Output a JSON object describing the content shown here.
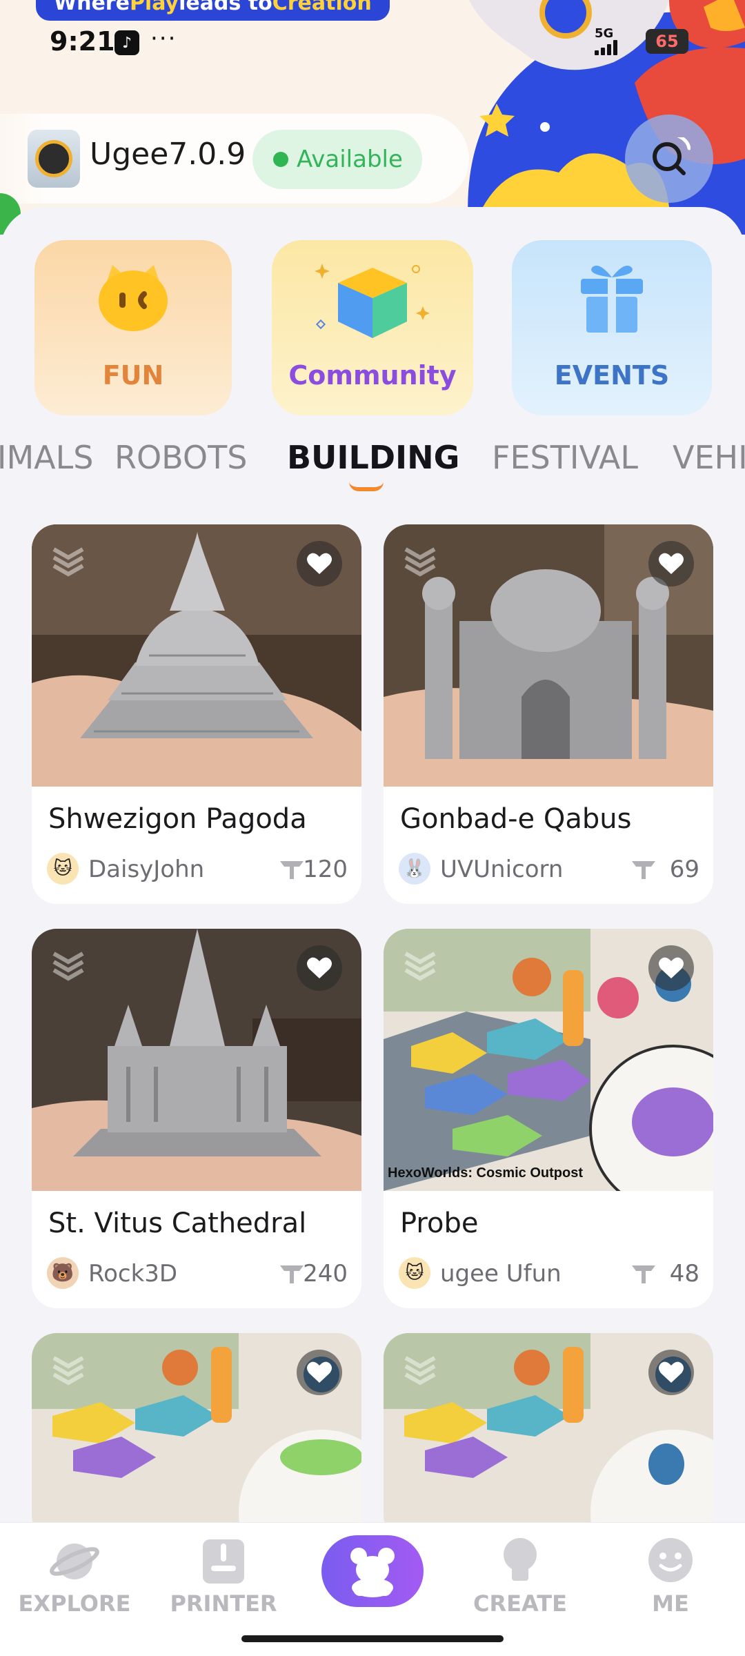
{
  "banner": {
    "prefix": "Where ",
    "play": "Play",
    "middle": " leads to ",
    "creation": "Creation"
  },
  "status_bar": {
    "time": "9:21",
    "network": "5G",
    "battery": "65",
    "more": "···"
  },
  "device": {
    "name": "Ugee7.0.9",
    "status": "Available"
  },
  "categories": [
    {
      "label": "FUN",
      "icon": "cat-face-icon"
    },
    {
      "label": "Community",
      "icon": "cube-icon"
    },
    {
      "label": "EVENTS",
      "icon": "gift-icon"
    }
  ],
  "tabs": [
    {
      "label": "ANIMALS",
      "active": false
    },
    {
      "label": "ROBOTS",
      "active": false
    },
    {
      "label": "BUILDING",
      "active": true
    },
    {
      "label": "FESTIVAL",
      "active": false
    },
    {
      "label": "VEHICLE",
      "active": false
    }
  ],
  "cards": [
    {
      "title": "Shwezigon Pagoda",
      "author": "DaisyJohn",
      "likes": "120",
      "image": "pagoda-model"
    },
    {
      "title": "Gonbad-e Qabus",
      "author": "UVUnicorn",
      "likes": "69",
      "image": "mosque-model"
    },
    {
      "title": "St. Vitus Cathedral",
      "author": "Rock3D",
      "likes": "240",
      "image": "cathedral-model"
    },
    {
      "title": "Probe",
      "author": "ugee Ufun",
      "likes": "48",
      "image": "hexoworlds-board",
      "caption": "HexoWorlds: Cosmic Outpost"
    },
    {
      "title": "",
      "author": "",
      "likes": "",
      "image": "hexoworlds-board"
    },
    {
      "title": "",
      "author": "",
      "likes": "",
      "image": "hexoworlds-board"
    }
  ],
  "bottom_nav": [
    {
      "label": "EXPLORE"
    },
    {
      "label": "PRINTER"
    },
    {
      "label": ""
    },
    {
      "label": "CREATE"
    },
    {
      "label": "ME"
    }
  ],
  "colors": {
    "accent": "#f28a2b",
    "nav_center": "#8a5cf0",
    "available": "#2fb552",
    "banner": "#2b46d6"
  }
}
